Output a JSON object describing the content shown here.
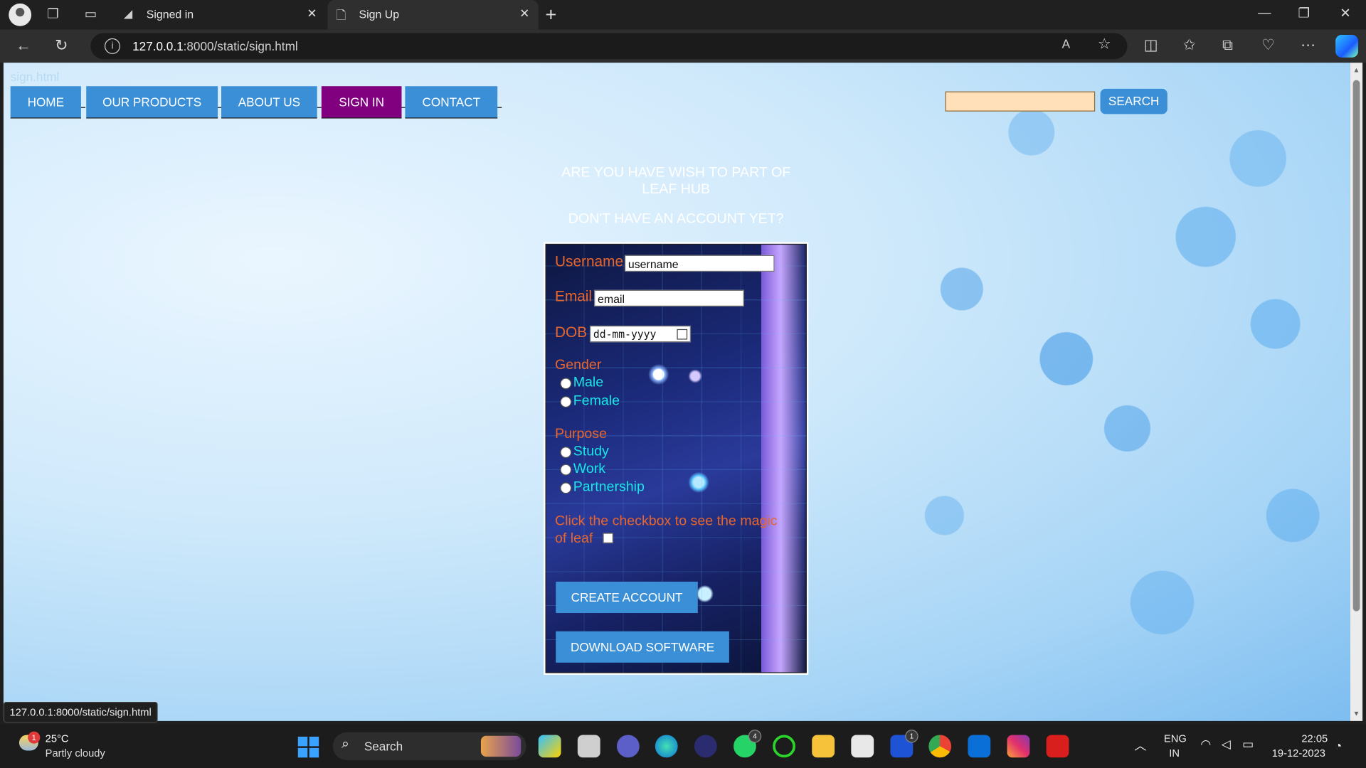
{
  "browser": {
    "tabs": [
      {
        "title": "Signed in",
        "active": false
      },
      {
        "title": "Sign Up",
        "active": true
      }
    ],
    "url_host": "127.0.0.1",
    "url_rest": ":8000/static/sign.html"
  },
  "page": {
    "ghost_title": "sign.html",
    "nav": [
      {
        "label": "HOME"
      },
      {
        "label": "OUR PRODUCTS"
      },
      {
        "label": "ABOUT US"
      },
      {
        "label": "SIGN IN"
      },
      {
        "label": "CONTACT"
      }
    ],
    "search": {
      "button": "SEARCH",
      "value": ""
    },
    "heading1": "ARE YOU HAVE WISH TO PART OF LEAF HUB",
    "heading2": "DON'T HAVE AN ACCOUNT YET?",
    "form": {
      "username_label": "Username",
      "username_value": "username",
      "email_label": "Email",
      "email_value": "email",
      "dob_label": "DOB",
      "dob_placeholder": "dd-mm-yyyy",
      "gender_label": "Gender",
      "gender_options": [
        "Male",
        "Female"
      ],
      "purpose_label": "Purpose",
      "purpose_options": [
        "Study",
        "Work",
        "Partnership"
      ],
      "checkbox_label": "Click the checkbox to see the magic of leaf",
      "create_button": "CREATE ACCOUNT",
      "download_button": "DOWNLOAD SOFTWARE"
    },
    "status_url": "127.0.0.1:8000/static/sign.html"
  },
  "taskbar": {
    "weather_temp": "25°C",
    "weather_desc": "Partly cloudy",
    "weather_badge": "1",
    "search_label": "Search",
    "lang1": "ENG",
    "lang2": "IN",
    "time": "22:05",
    "date": "19-12-2023",
    "badges": {
      "whatsapp": "4",
      "l_app": "1"
    }
  },
  "colors": {
    "nav_blue": "#3a8fd6",
    "sign_in_purple": "#800080",
    "label_orange": "#e8652c",
    "option_cyan": "#19e6e6"
  }
}
